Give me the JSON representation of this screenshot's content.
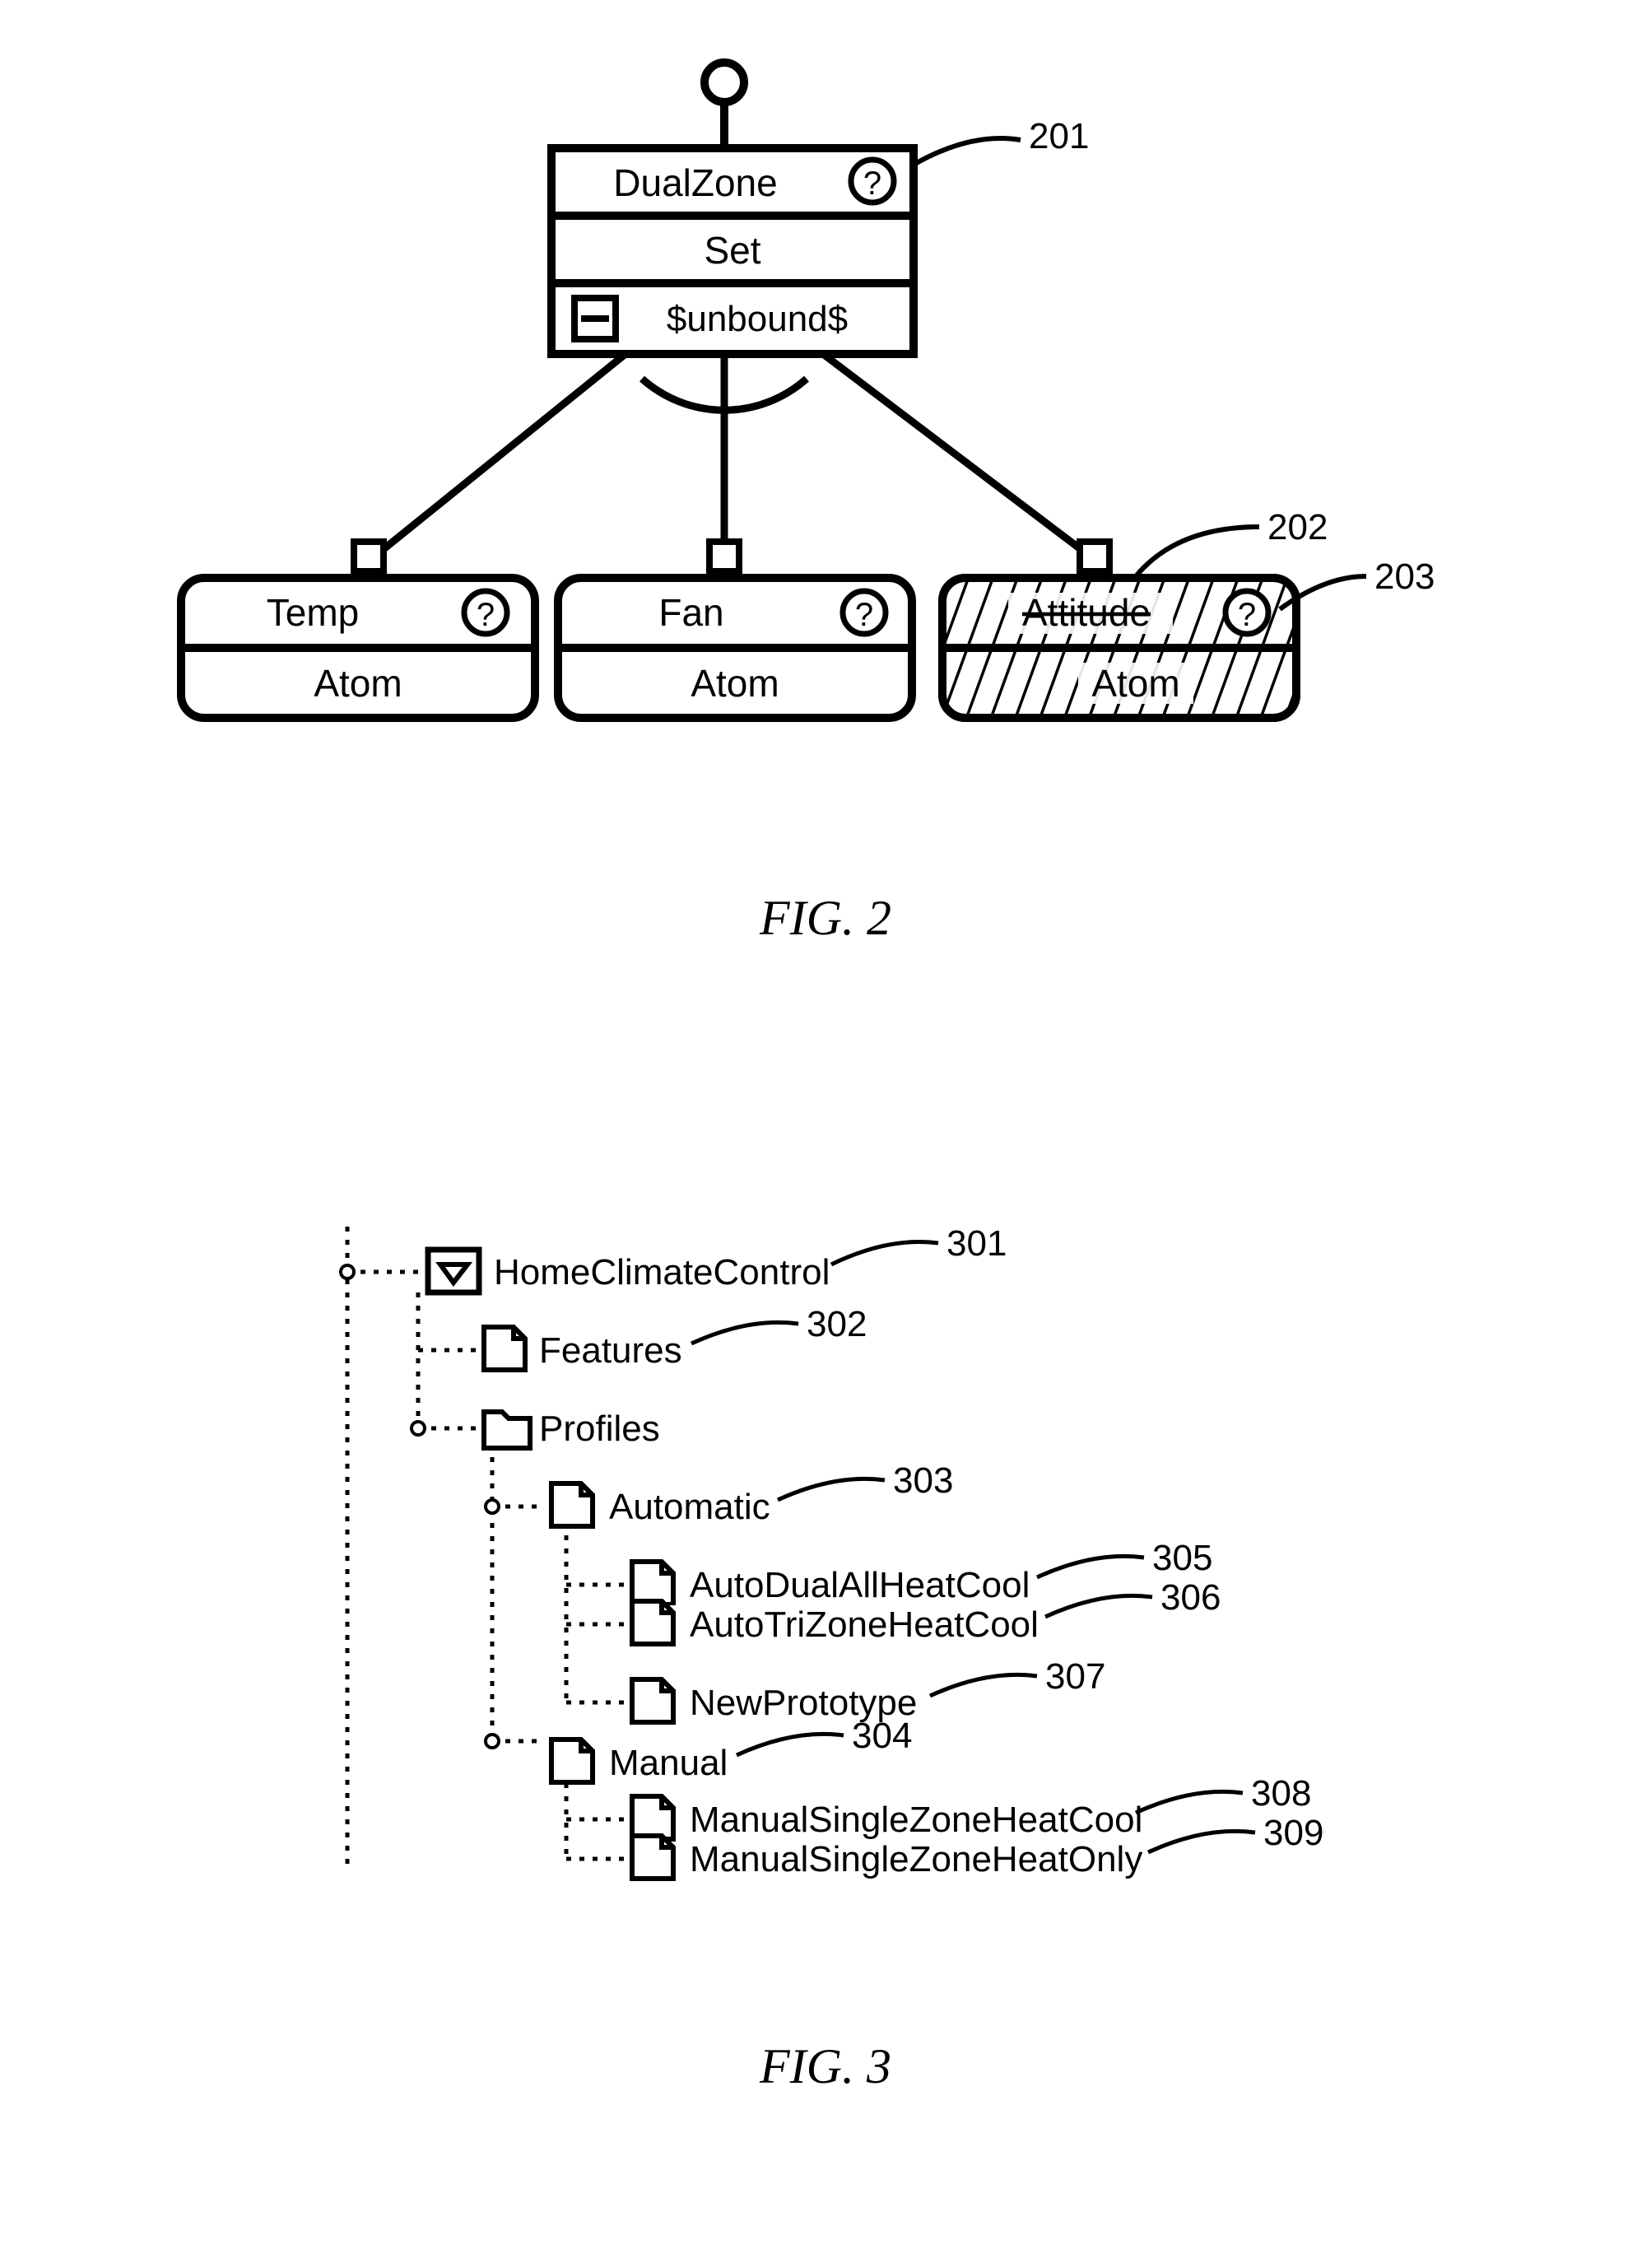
{
  "fig2": {
    "caption": "FIG.  2",
    "root": {
      "title": "DualZone",
      "row2": "Set",
      "row3": "$unbound$",
      "callout": "201"
    },
    "children": [
      {
        "title": "Temp",
        "subtitle": "Atom"
      },
      {
        "title": "Fan",
        "subtitle": "Atom"
      },
      {
        "title": "Attitude",
        "subtitle": "Atom",
        "hatched": true,
        "strike": true,
        "calloutA": "202",
        "calloutB": "203"
      }
    ]
  },
  "fig3": {
    "caption": "FIG.  3",
    "tree": {
      "root": {
        "label": "HomeClimateControl",
        "callout": "301"
      },
      "features": {
        "label": "Features",
        "callout": "302"
      },
      "profiles": {
        "label": "Profiles"
      },
      "automatic": {
        "label": "Automatic",
        "callout": "303"
      },
      "auto1": {
        "label": "AutoDualAllHeatCool",
        "callout": "305"
      },
      "auto2": {
        "label": "AutoTriZoneHeatCool",
        "callout": "306"
      },
      "auto3": {
        "label": "NewPrototype",
        "callout": "307"
      },
      "manual": {
        "label": "Manual",
        "callout": "304"
      },
      "man1": {
        "label": "ManualSingleZoneHeatCool",
        "callout": "308"
      },
      "man2": {
        "label": "ManualSingleZoneHeatOnly",
        "callout": "309"
      }
    }
  }
}
